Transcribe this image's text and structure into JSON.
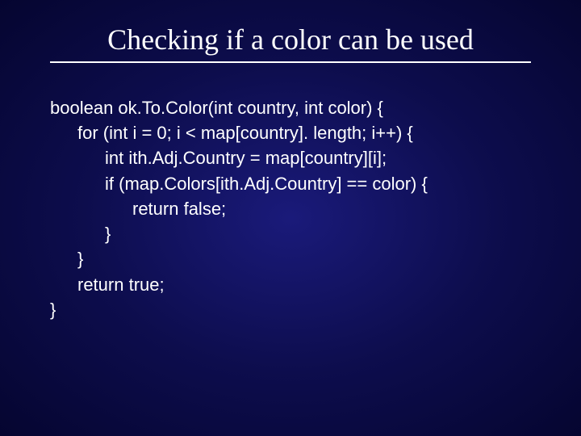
{
  "title": "Checking if a color can be used",
  "code": {
    "l1": "boolean ok.To.Color(int country, int color) {",
    "l2": "for (int i = 0; i < map[country]. length; i++) {",
    "l3": "int ith.Adj.Country = map[country][i];",
    "l4": "if (map.Colors[ith.Adj.Country] == color) {",
    "l5": "return false;",
    "l6": "}",
    "l7": "}",
    "l8": "return true;",
    "l9": "}"
  }
}
